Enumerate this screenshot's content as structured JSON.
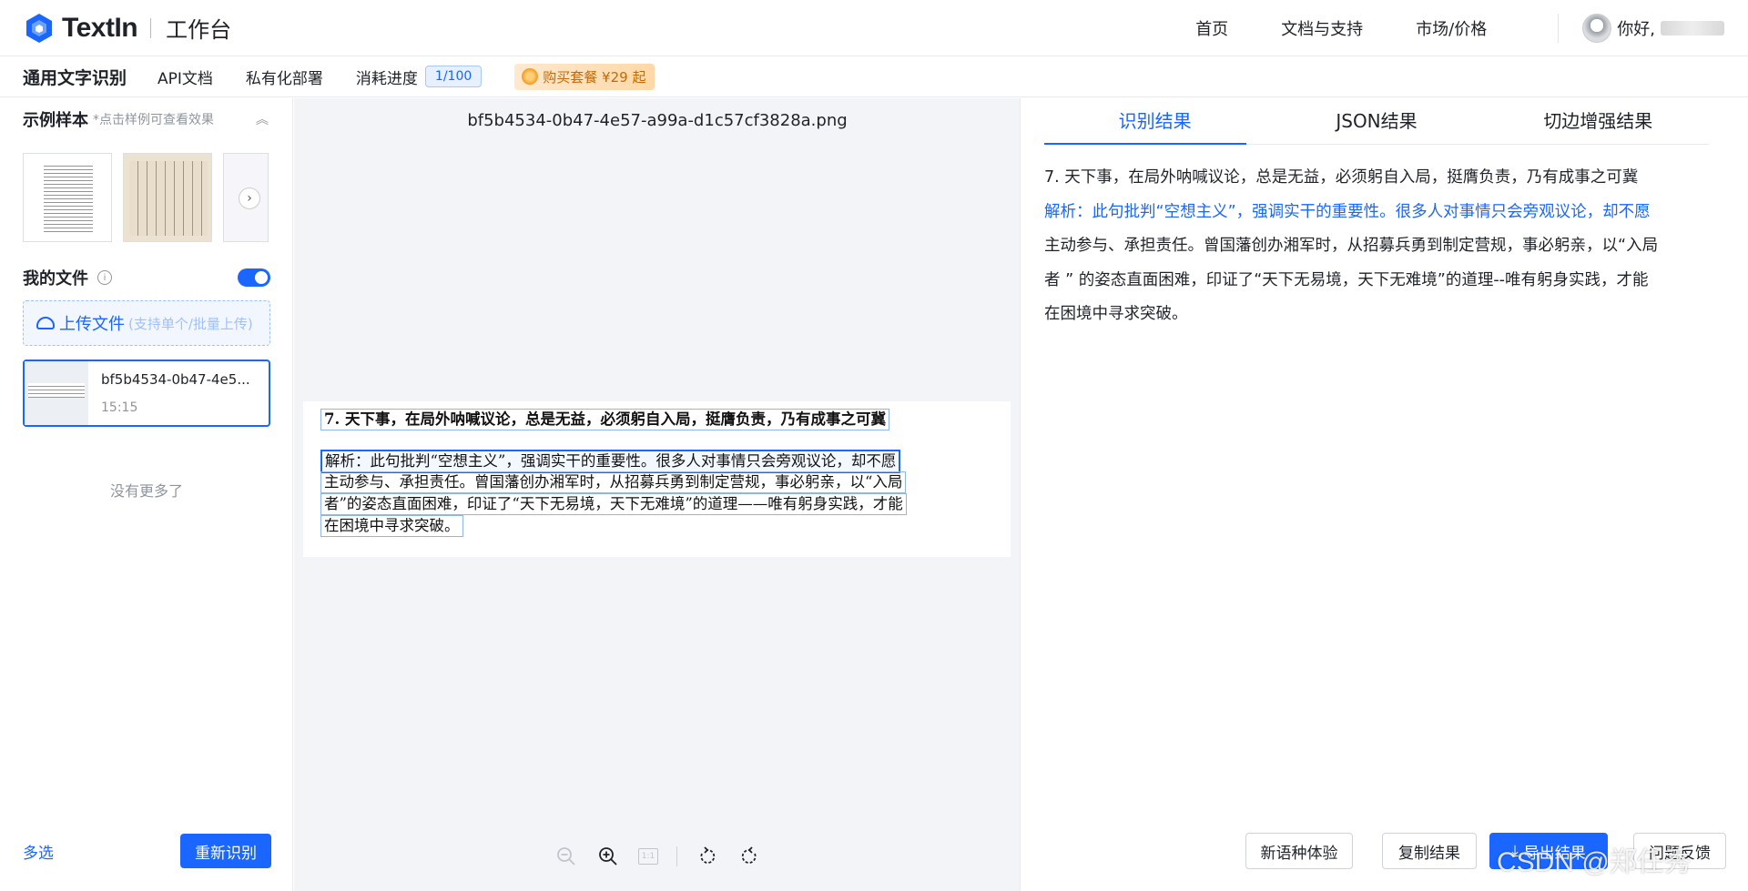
{
  "topnav": {
    "logo_text": "TextIn",
    "workspace": "工作台",
    "links": [
      "首页",
      "文档与支持",
      "市场/价格"
    ],
    "greeting": "你好,"
  },
  "subnav": {
    "title": "通用文字识别",
    "items": [
      "API文档",
      "私有化部署"
    ],
    "usage_label": "消耗进度",
    "usage_value": "1/100",
    "buy_label": "购买套餐 ¥29 起"
  },
  "sidebar": {
    "samples_title": "示例样本",
    "samples_hint": "*点击样例可查看效果",
    "myfiles_title": "我的文件",
    "upload_label": "上传文件",
    "upload_hint": "(支持单个/批量上传)",
    "file": {
      "name": "bf5b4534-0b47-4e5...",
      "time": "15:15"
    },
    "no_more": "没有更多了",
    "multi_select": "多选",
    "reocr": "重新识别"
  },
  "viewer": {
    "filename": "bf5b4534-0b47-4e57-a99a-d1c57cf3828a.png",
    "lines": [
      "7. 天下事，在局外呐喊议论，总是无益，必须躬自入局，挺膺负责，乃有成事之可冀",
      "解析：此句批判“空想主义”，强调实干的重要性。很多人对事情只会旁观议论，却不愿",
      "主动参与、承担责任。曾国藩创办湘军时，从招募兵勇到制定营规，事必躬亲，以“入局",
      "者”的姿态直面困难，印证了“天下无易境，天下无难境”的道理——唯有躬身实践，才能",
      "在困境中寻求突破。"
    ],
    "zoom_fit": "1:1"
  },
  "result": {
    "tabs": [
      "识别结果",
      "JSON结果",
      "切边增强结果"
    ],
    "lines": [
      "7. 天下事，在局外呐喊议论，总是无益，必须躬自入局，挺膺负责，乃有成事之可冀",
      "解析：此句批判“空想主义”，强调实干的重要性。很多人对事情只会旁观议论，却不愿",
      "主动参与、承担责任。曾国藩创办湘军时，从招募兵勇到制定营规，事必躬亲，以“入局",
      "者 ” 的姿态直面困难，印证了“天下无易境，天下无难境”的道理--唯有躬身实践，才能",
      "在困境中寻求突破。"
    ],
    "buttons": {
      "new_lang": "新语种体验",
      "copy": "复制结果",
      "export": "导出结果",
      "feedback": "问题反馈"
    }
  },
  "watermark": "CSDN @郑任秀",
  "colors": {
    "accent": "#1a66ff",
    "border": "#e8eaed",
    "muted": "#8f959e"
  }
}
